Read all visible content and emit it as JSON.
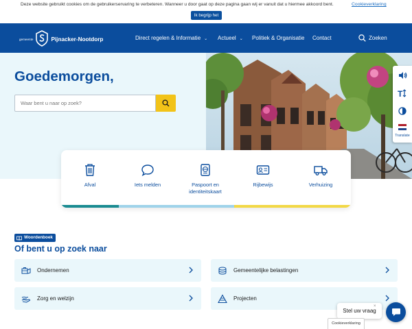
{
  "cookie": {
    "message": "Deze website gebruikt cookies om de gebruikerservaring te verbeteren. Wanneer u door gaat op deze pagina gaan wij er vanuit dat u hiermee akkoord bent.",
    "link_label": "Cookieverklaring",
    "accept_label": "Ik begrijp het"
  },
  "header": {
    "logo_prefix": "gemeente",
    "logo_name": "Pijnacker-Nootdorp",
    "nav": [
      {
        "label": "Direct regelen & Informatie",
        "has_dropdown": true
      },
      {
        "label": "Actueel",
        "has_dropdown": true
      },
      {
        "label": "Politiek & Organisatie",
        "has_dropdown": false
      },
      {
        "label": "Contact",
        "has_dropdown": false
      }
    ],
    "search_label": "Zoeken"
  },
  "hero": {
    "greeting": "Goedemorgen,",
    "search_placeholder": "Waar bent u naar op zoek?"
  },
  "a11y": {
    "translate_label": "Translate"
  },
  "services": [
    {
      "label": "Afval",
      "icon": "trash-icon"
    },
    {
      "label": "Iets melden",
      "icon": "speech-bubble-icon"
    },
    {
      "label": "Paspoort en identiteitskaart",
      "icon": "passport-icon"
    },
    {
      "label": "Rijbewijs",
      "icon": "id-card-icon"
    },
    {
      "label": "Verhuizing",
      "icon": "truck-icon"
    }
  ],
  "dictionary": {
    "badge": "Woordenboek",
    "title": "Of bent u op zoek naar"
  },
  "topics": [
    {
      "label": "Ondernemen",
      "icon": "business-icon"
    },
    {
      "label": "Gemeentelijke belastingen",
      "icon": "coins-icon"
    },
    {
      "label": "Zorg en welzijn",
      "icon": "care-hands-icon"
    },
    {
      "label": "Projecten",
      "icon": "construction-icon"
    }
  ],
  "chat": {
    "prompt": "Stel uw vraag",
    "close": "×"
  },
  "cookie_tab": "Cookieverklaring",
  "colors": {
    "brand_blue": "#0b4d9d",
    "accent_yellow": "#f2c318",
    "light_bg": "#eaf7fb",
    "stripe_teal": "#1a8b91",
    "stripe_lightblue": "#9fd3ea",
    "stripe_yellow": "#f2d846"
  }
}
